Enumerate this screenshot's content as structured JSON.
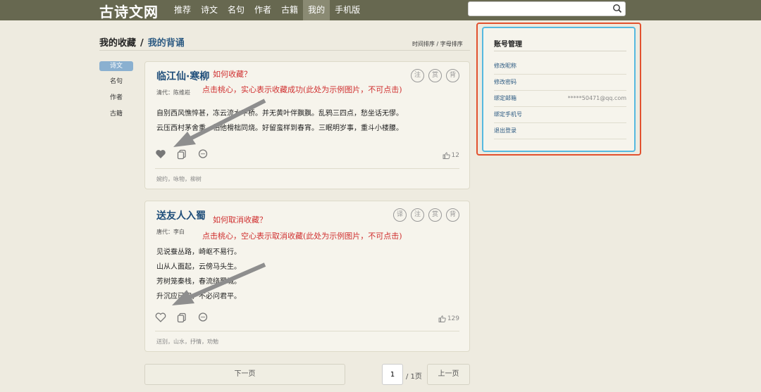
{
  "app": {
    "logo": "古诗文网"
  },
  "nav": [
    {
      "label": "推荐",
      "active": false
    },
    {
      "label": "诗文",
      "active": false
    },
    {
      "label": "名句",
      "active": false
    },
    {
      "label": "作者",
      "active": false
    },
    {
      "label": "古籍",
      "active": false
    },
    {
      "label": "我的",
      "active": true
    },
    {
      "label": "手机版",
      "active": false
    }
  ],
  "search": {
    "value": "",
    "icon": "search-icon"
  },
  "heading": {
    "title": "我的收藏",
    "separator": "/",
    "subtitle": "我的背诵"
  },
  "sort": {
    "time": "时间排序",
    "sep": " / ",
    "alpha": "字母排序"
  },
  "left_tabs": [
    {
      "label": "诗文",
      "active": true
    },
    {
      "label": "名句",
      "active": false
    },
    {
      "label": "作者",
      "active": false
    },
    {
      "label": "古籍",
      "active": false
    }
  ],
  "poems": [
    {
      "title": "临江仙·寒柳",
      "author": "清代：陈维崧",
      "lines": [
        "自别西风憔悴甚，冻云流水平桥。并无黄叶伴飘飘。乱鸦三四点，愁坐话无憀。",
        "云压西村茅舍重，怕他榾柮同烧。好留蛮样到春宵。三眠明岁事，重斗小楼腰。"
      ],
      "badges": [
        "注",
        "赏",
        "背"
      ],
      "likes": "12",
      "tags": "婉约，咏物，柳树",
      "favorited": true,
      "annot_question": "如何收藏？",
      "annot_desc": "点击桃心，实心表示收藏成功(此处为示例图片，不可点击)"
    },
    {
      "title": "送友人入蜀",
      "author": "唐代：李白",
      "lines": [
        "见说蚕丛路，崎岖不易行。",
        "山从人面起，云傍马头生。",
        "芳树笼秦栈，春流绕蜀城。",
        "升沉应已定，不必问君平。"
      ],
      "badges": [
        "译",
        "注",
        "赏",
        "背"
      ],
      "likes": "129",
      "tags": "送别，山水，抒情，劝勉",
      "favorited": false,
      "annot_question": "如何取消收藏？",
      "annot_desc": "点击桃心，空心表示取消收藏(此处为示例图片，不可点击)"
    }
  ],
  "pager": {
    "next": "下一页",
    "page": "1",
    "total": "/ 1页",
    "prev": "上一页"
  },
  "account": {
    "title": "账号管理",
    "items": [
      {
        "label": "修改昵称",
        "value": ""
      },
      {
        "label": "修改密码",
        "value": ""
      },
      {
        "label": "绑定邮箱",
        "value": "*****50471@qq.com"
      },
      {
        "label": "绑定手机号",
        "value": ""
      },
      {
        "label": "退出登录",
        "value": ""
      }
    ]
  },
  "colors": {
    "nav_bg": "#676850",
    "page_bg": "#eeebe0",
    "link": "#2c5a82",
    "annotation": "#d03030",
    "highlight_outer": "#e2512f",
    "highlight_inner": "#56b9e0"
  }
}
